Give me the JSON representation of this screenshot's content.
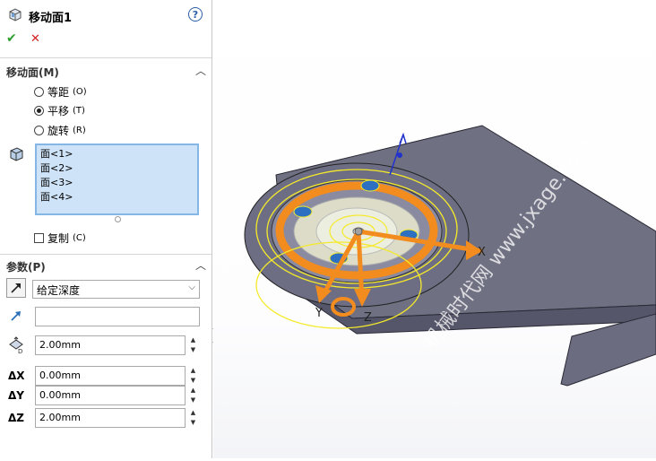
{
  "panel": {
    "title": "移动面1",
    "help_glyph": "?",
    "ok_glyph": "✔",
    "cancel_glyph": "✕"
  },
  "move_face": {
    "header": "移动面(M)",
    "options": [
      {
        "label": "等距",
        "suffix": "(O)",
        "selected": false
      },
      {
        "label": "平移",
        "suffix": "(T)",
        "selected": true
      },
      {
        "label": "旋转",
        "suffix": "(R)",
        "selected": false
      }
    ],
    "faces": [
      "面<1>",
      "面<2>",
      "面<3>",
      "面<4>"
    ],
    "copy_label": "复制",
    "copy_suffix": "(C)"
  },
  "params": {
    "header": "参数(P)",
    "end_condition": "给定深度",
    "direction_value": "",
    "distance": "2.00mm",
    "dx_label": "ΔX",
    "dx": "0.00mm",
    "dy_label": "ΔY",
    "dy": "0.00mm",
    "dz_label": "ΔZ",
    "dz": "2.00mm"
  },
  "viewport": {
    "triad": {
      "x": "X",
      "y": "Y",
      "z": "Z"
    },
    "watermark": "机械时代网 www.jxage.com"
  },
  "colors": {
    "accent_orange": "#f28c1e",
    "model_gray": "#6f7082",
    "selection_blue": "#cfe3f8",
    "ok_green": "#2e9e2e",
    "cancel_red": "#d02020"
  }
}
